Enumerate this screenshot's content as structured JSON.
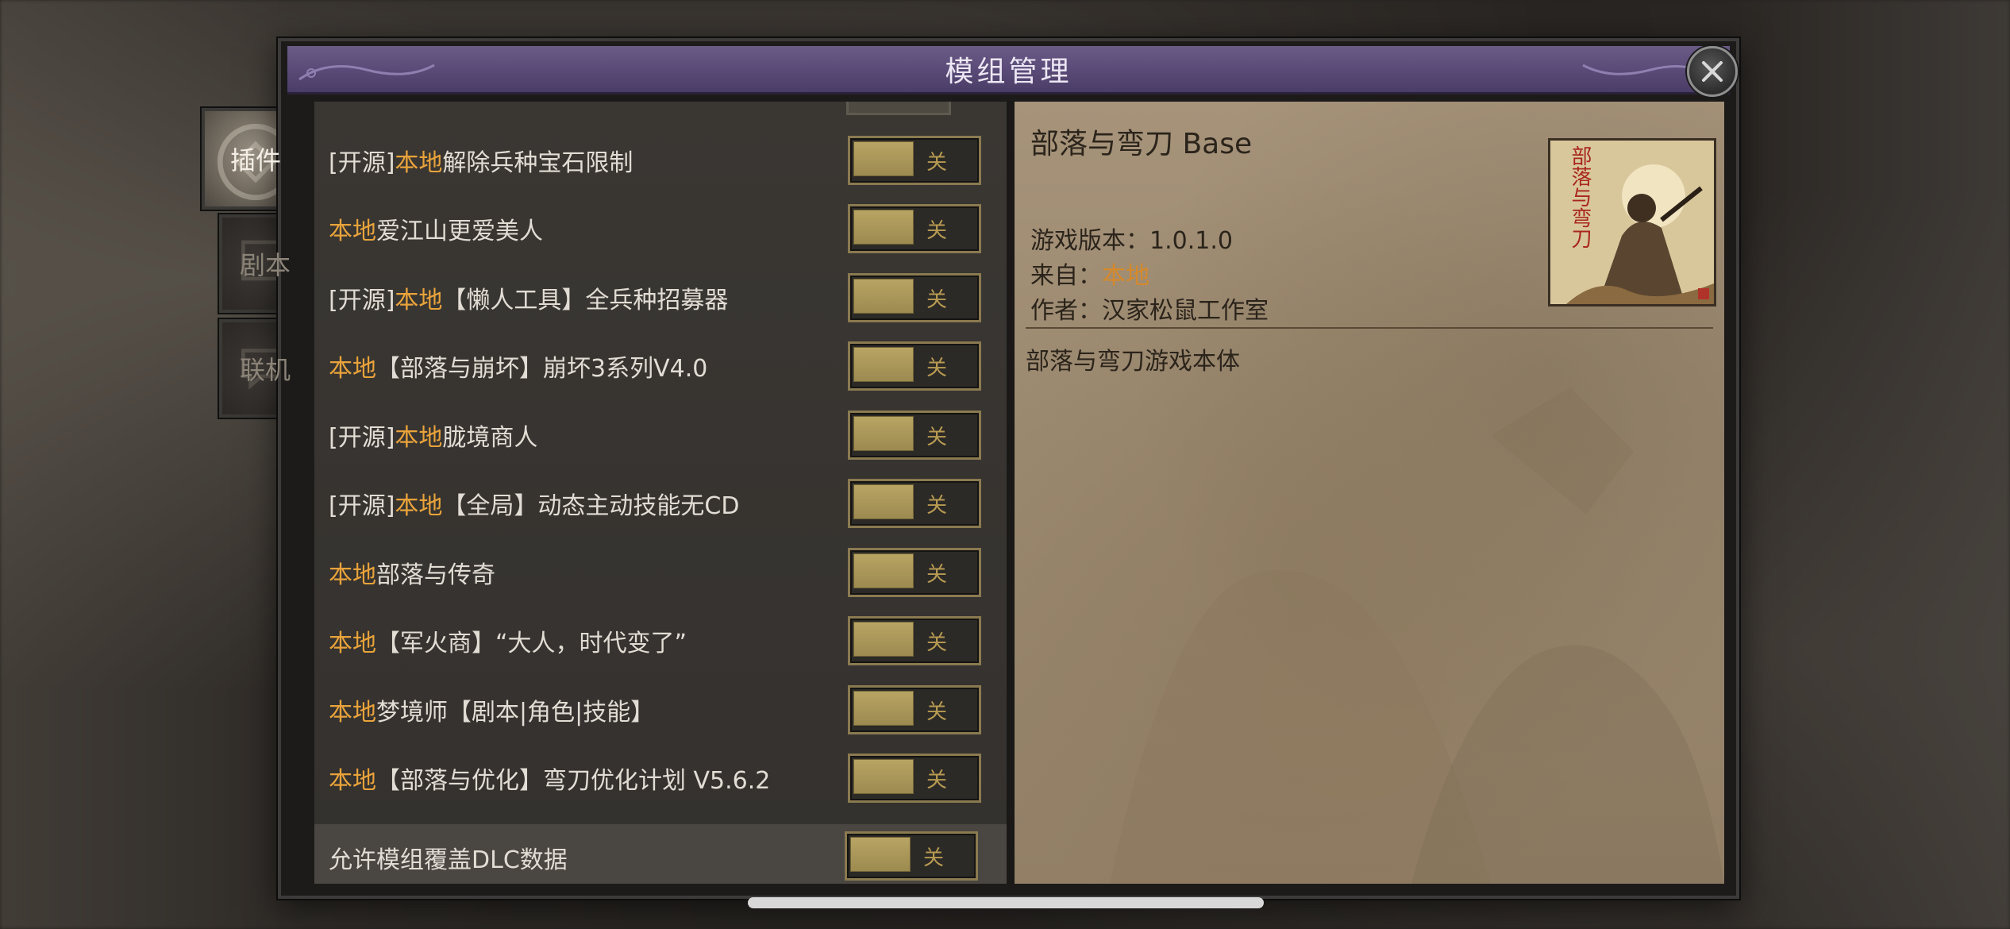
{
  "window": {
    "title": "模组管理"
  },
  "tabs": [
    {
      "label": "插件",
      "active": true
    },
    {
      "label": "剧本",
      "active": false
    },
    {
      "label": "联机",
      "active": false
    }
  ],
  "mods": [
    {
      "prefix": "[开源]",
      "source": "本地",
      "name": "解除兵种宝石限制",
      "toggle": "关"
    },
    {
      "prefix": "",
      "source": "本地",
      "name": "爱江山更爱美人",
      "toggle": "关"
    },
    {
      "prefix": "[开源]",
      "source": "本地",
      "name": "【懒人工具】全兵种招募器",
      "toggle": "关"
    },
    {
      "prefix": "",
      "source": "本地",
      "name": "【部落与崩坏】崩坏3系列V4.0",
      "toggle": "关"
    },
    {
      "prefix": "[开源]",
      "source": "本地",
      "name": "胧境商人",
      "toggle": "关"
    },
    {
      "prefix": "[开源]",
      "source": "本地",
      "name": "【全局】动态主动技能无CD",
      "toggle": "关"
    },
    {
      "prefix": "",
      "source": "本地",
      "name": "部落与传奇",
      "toggle": "关"
    },
    {
      "prefix": "",
      "source": "本地",
      "name": "【军火商】“大人，时代变了”",
      "toggle": "关"
    },
    {
      "prefix": "",
      "source": "本地",
      "name": "梦境师【剧本|角色|技能】",
      "toggle": "关"
    },
    {
      "prefix": "",
      "source": "本地",
      "name": "【部落与优化】弯刀优化计划 V5.6.2",
      "toggle": "关"
    }
  ],
  "dlc_override": {
    "label": "允许模组覆盖DLC数据",
    "toggle": "关"
  },
  "detail": {
    "title": "部落与弯刀 Base",
    "version_label": "游戏版本：",
    "version_value": "1.0.1.0",
    "source_label": "来自：",
    "source_value": "本地",
    "author_label": "作者：",
    "author_value": "汉家松鼠工作室",
    "description": "部落与弯刀游戏本体",
    "cover_text": "部落与弯刀"
  },
  "colors": {
    "local_source": "#e9a33b",
    "title_bar": "#5a4b78",
    "toggle_knob": "#b8a463"
  }
}
